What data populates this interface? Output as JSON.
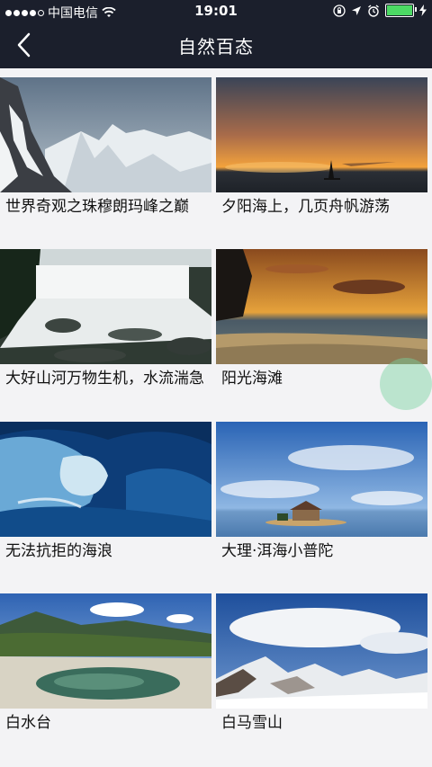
{
  "status": {
    "carrier": "中国电信",
    "time": "19:01"
  },
  "nav": {
    "title": "自然百态"
  },
  "items": [
    {
      "caption": "世界奇观之珠穆朗玛峰之巅"
    },
    {
      "caption": "夕阳海上，几页舟帆游荡"
    },
    {
      "caption": "大好山河万物生机，水流湍急"
    },
    {
      "caption": "阳光海滩"
    },
    {
      "caption": "无法抗拒的海浪"
    },
    {
      "caption": "大理·洱海小普陀"
    },
    {
      "caption": "白水台"
    },
    {
      "caption": "白马雪山"
    }
  ]
}
